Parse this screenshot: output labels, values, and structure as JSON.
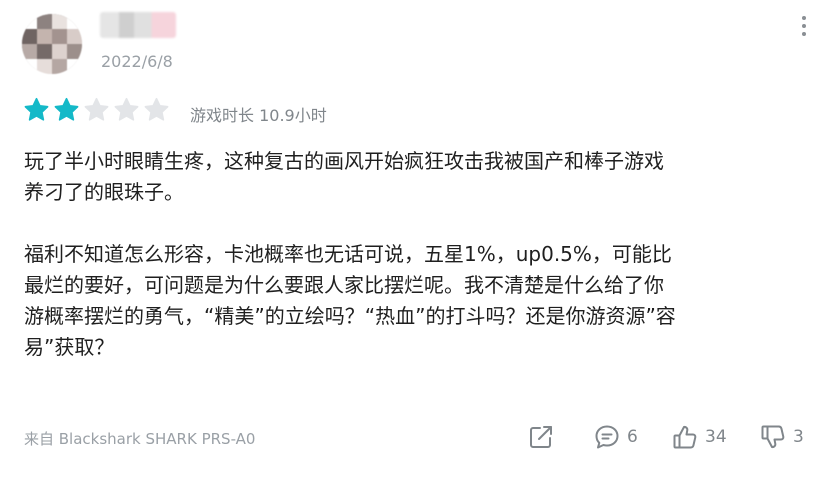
{
  "review": {
    "date": "2022/6/8",
    "rating": 2,
    "max_rating": 5,
    "playtime": "游戏时长 10.9小时",
    "paragraphs": [
      "玩了半小时眼睛生疼，这种复古的画风开始疯狂攻击我被国产和棒子游戏\n养刁了的眼珠子。",
      "福利不知道怎么形容，卡池概率也无话可说，五星1%，up0.5%，可能比\n最烂的要好，可问题是为什么要跟人家比摆烂呢。我不清楚是什么给了你\n游概率摆烂的勇气，“精美”的立绘吗？“热血”的打斗吗？还是你游资源”容\n易”获取？"
    ],
    "device": "来自 Blackshark SHARK PRS-A0"
  },
  "actions": {
    "comments_count": "6",
    "likes_count": "34",
    "dislikes_count": "3"
  },
  "icons": {
    "more": "more-vertical-icon",
    "share": "share-icon",
    "comment": "comment-icon",
    "like": "thumbs-up-icon",
    "dislike": "thumbs-down-icon",
    "star": "star-icon"
  },
  "colors": {
    "star_filled": "#14b9c8",
    "star_empty": "#e3e5e8",
    "icon_gray": "#80868b"
  }
}
